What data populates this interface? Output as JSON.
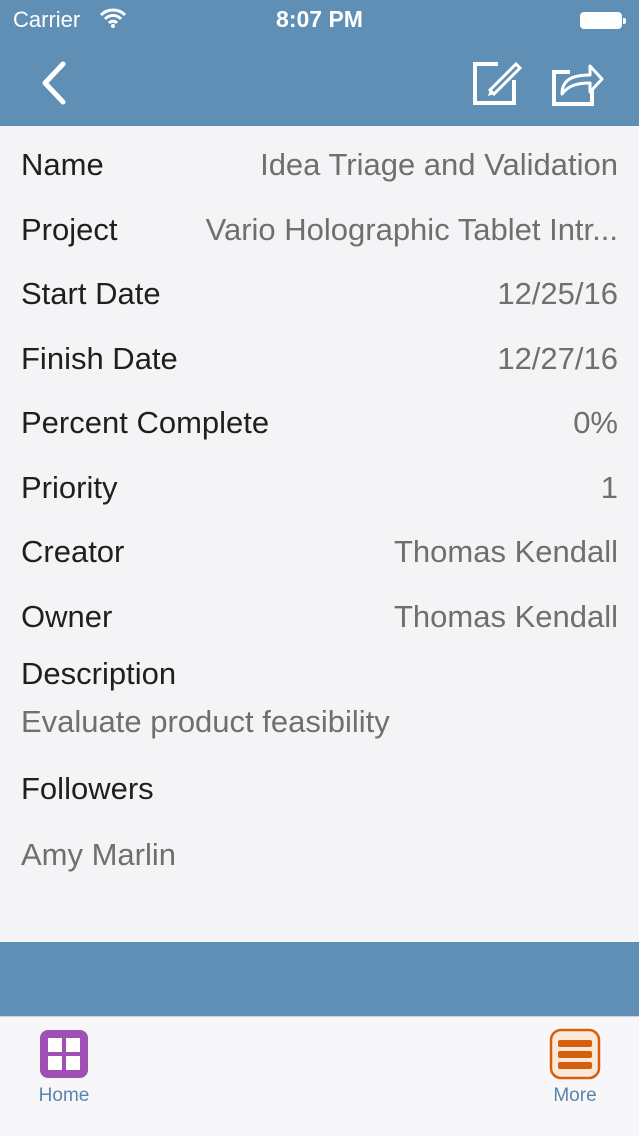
{
  "status_bar": {
    "carrier": "Carrier",
    "time": "8:07 PM"
  },
  "nav": {
    "back_icon": "chevron-left-icon",
    "edit_icon": "compose-icon",
    "share_icon": "share-icon"
  },
  "details": {
    "fields": [
      {
        "label": "Name",
        "value": "Idea Triage and Validation"
      },
      {
        "label": "Project",
        "value": "Vario Holographic Tablet Intr..."
      },
      {
        "label": "Start Date",
        "value": "12/25/16"
      },
      {
        "label": "Finish Date",
        "value": "12/27/16"
      },
      {
        "label": "Percent Complete",
        "value": "0%"
      },
      {
        "label": "Priority",
        "value": "1"
      },
      {
        "label": "Creator",
        "value": "Thomas Kendall"
      },
      {
        "label": "Owner",
        "value": "Thomas Kendall"
      }
    ],
    "description_label": "Description",
    "description_value": "Evaluate product feasibility",
    "followers_label": "Followers",
    "followers": [
      "Amy Marlin"
    ]
  },
  "tabbar": {
    "home_label": "Home",
    "more_label": "More"
  },
  "colors": {
    "header": "#5f8fb5",
    "home_icon": "#a04fb4",
    "more_icon": "#d45f0e",
    "tab_label": "#5a85aa"
  }
}
